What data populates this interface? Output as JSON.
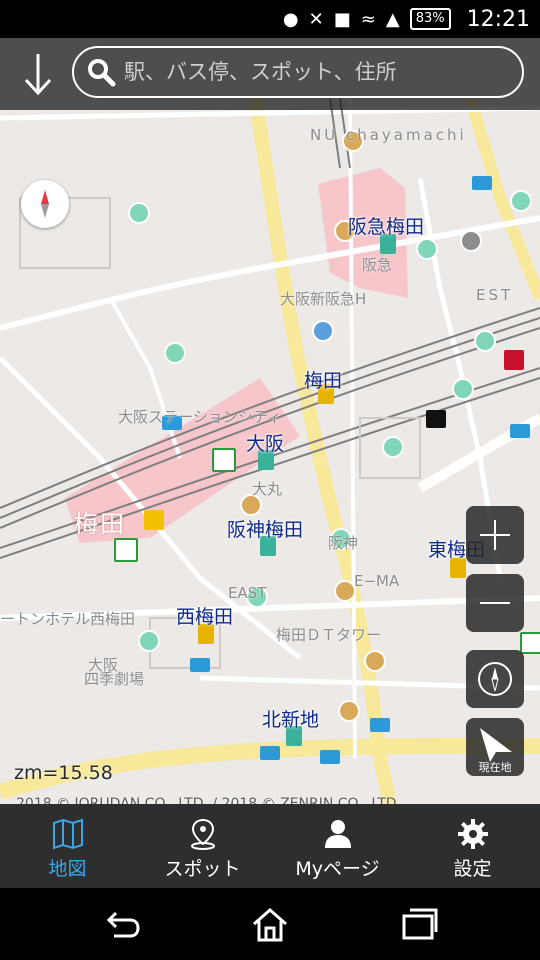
{
  "status_bar": {
    "battery": "83%",
    "time": "12:21"
  },
  "search": {
    "placeholder": "駅、バス停、スポット、住所"
  },
  "map": {
    "stations": [
      "阪急梅田",
      "梅田",
      "大阪",
      "阪神梅田",
      "東梅田",
      "西梅田",
      "北新地"
    ],
    "labels": [
      "阪急",
      "大阪新阪急H",
      "大阪ステーションシティ",
      "大丸",
      "阪神",
      "EAST",
      "E−MA",
      "梅田ＤＴタワー",
      "ートンホテル西梅田",
      "大阪",
      "四季劇場",
      "NU chayamachi",
      "梅田",
      "EST"
    ],
    "zoom_text": "zm=15.58",
    "copyright": "2018 © JORUDAN CO., LTD. / 2018 © ZENRIN CO., LTD.",
    "current_location_label": "現在地"
  },
  "tabs": [
    {
      "label": "地図",
      "icon": "map-icon",
      "active": true
    },
    {
      "label": "スポット",
      "icon": "pin-icon",
      "active": false
    },
    {
      "label": "Myページ",
      "icon": "person-icon",
      "active": false
    },
    {
      "label": "設定",
      "icon": "gear-icon",
      "active": false
    }
  ],
  "colors": {
    "accent": "#3aa6ea",
    "station_text": "#0d2a8a",
    "station_area": "#f6c6cb"
  }
}
